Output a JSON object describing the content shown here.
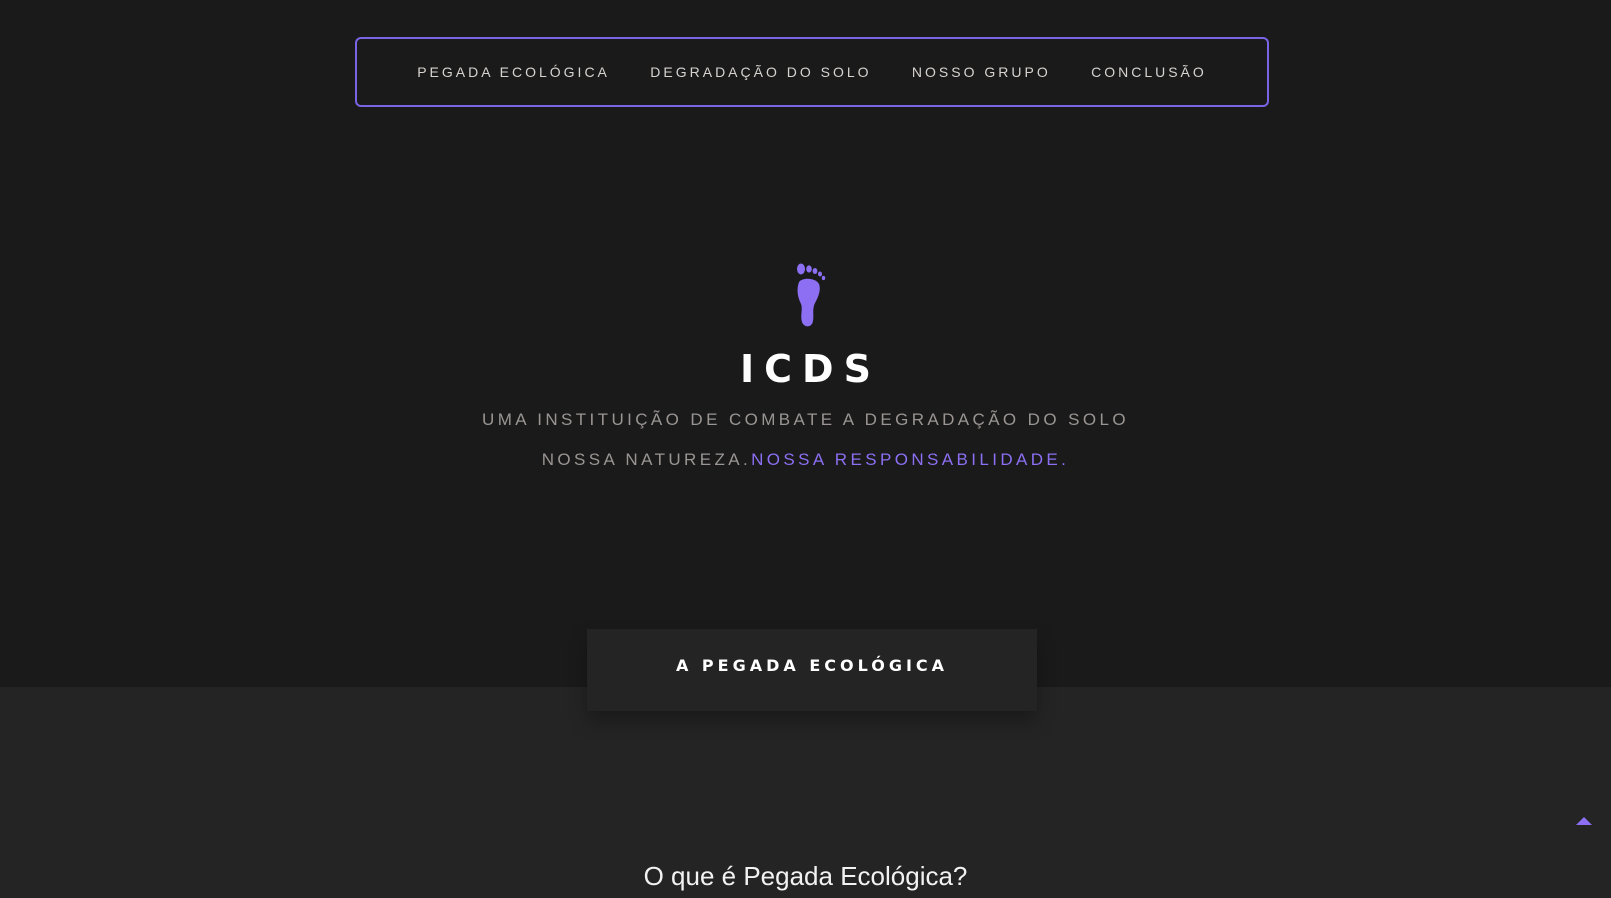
{
  "nav": {
    "items": [
      {
        "label": "PEGADA ECOLÓGICA"
      },
      {
        "label": "DEGRADAÇÃO DO SOLO"
      },
      {
        "label": "NOSSO GRUPO"
      },
      {
        "label": "CONCLUSÃO"
      }
    ]
  },
  "hero": {
    "icon": "footprint-icon",
    "brand": "ICDS",
    "subtitle": "UMA INSTITUIÇÃO DE COMBATE A DEGRADAÇÃO DO SOLO",
    "tagline_prefix": "NOSSA NATUREZA.",
    "tagline_accent": "NOSSA RESPONSABILIDADE",
    "tagline_suffix": "."
  },
  "section": {
    "tab_label": "A PEGADA ECOLÓGICA",
    "question": "O que é Pegada Ecológica?"
  },
  "back_to_top": {
    "icon": "caret-up-icon"
  },
  "colors": {
    "background": "#1a1a1b",
    "section_background": "#242425",
    "accent": "#8c6ff2",
    "nav_border": "#7b63e6",
    "muted_text": "#9a9592"
  }
}
